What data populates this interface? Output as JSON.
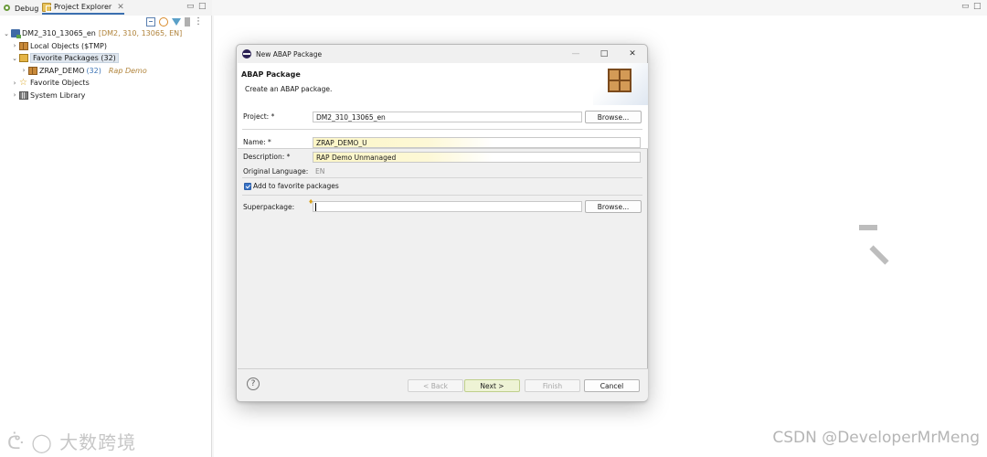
{
  "left_panel": {
    "tabs": [
      {
        "label": "Debug",
        "icon": "debug-icon"
      },
      {
        "label": "Project Explorer",
        "icon": "project-explorer-icon"
      }
    ],
    "tree": {
      "project": {
        "name": "DM2_310_13065_en",
        "detail": "[DM2, 310, 13065, EN]"
      },
      "local_objects": "Local Objects ($TMP)",
      "favorite_packages": "Favorite Packages (32)",
      "zrap_demo": {
        "name": "ZRAP_DEMO",
        "count": "(32)",
        "description": "Rap Demo"
      },
      "favorite_objects": "Favorite Objects",
      "system_library": "System Library"
    }
  },
  "dialog": {
    "title": "New ABAP Package",
    "header": {
      "title": "ABAP Package",
      "description": "Create an ABAP package."
    },
    "project": {
      "label": "Project: *",
      "value": "DM2_310_13065_en"
    },
    "browse_label": "Browse...",
    "name": {
      "label": "Name: *",
      "value": "ZRAP_DEMO_U"
    },
    "description": {
      "label": "Description: *",
      "value": "RAP Demo Unmanaged"
    },
    "original_language": {
      "label": "Original Language:",
      "value": "EN"
    },
    "add_favorite": {
      "label": "Add to favorite packages",
      "checked": true
    },
    "superpackage": {
      "label": "Superpackage:",
      "value": ""
    },
    "buttons": {
      "back": "< Back",
      "next": "Next >",
      "finish": "Finish",
      "cancel": "Cancel"
    },
    "help_symbol": "?"
  },
  "watermarks": {
    "left": "大数跨境",
    "right": "CSDN @DeveloperMrMeng"
  },
  "colors": {
    "accent": "#3a74c7",
    "highlight": "#fcf6c6",
    "next_button": "#eef3d5"
  }
}
